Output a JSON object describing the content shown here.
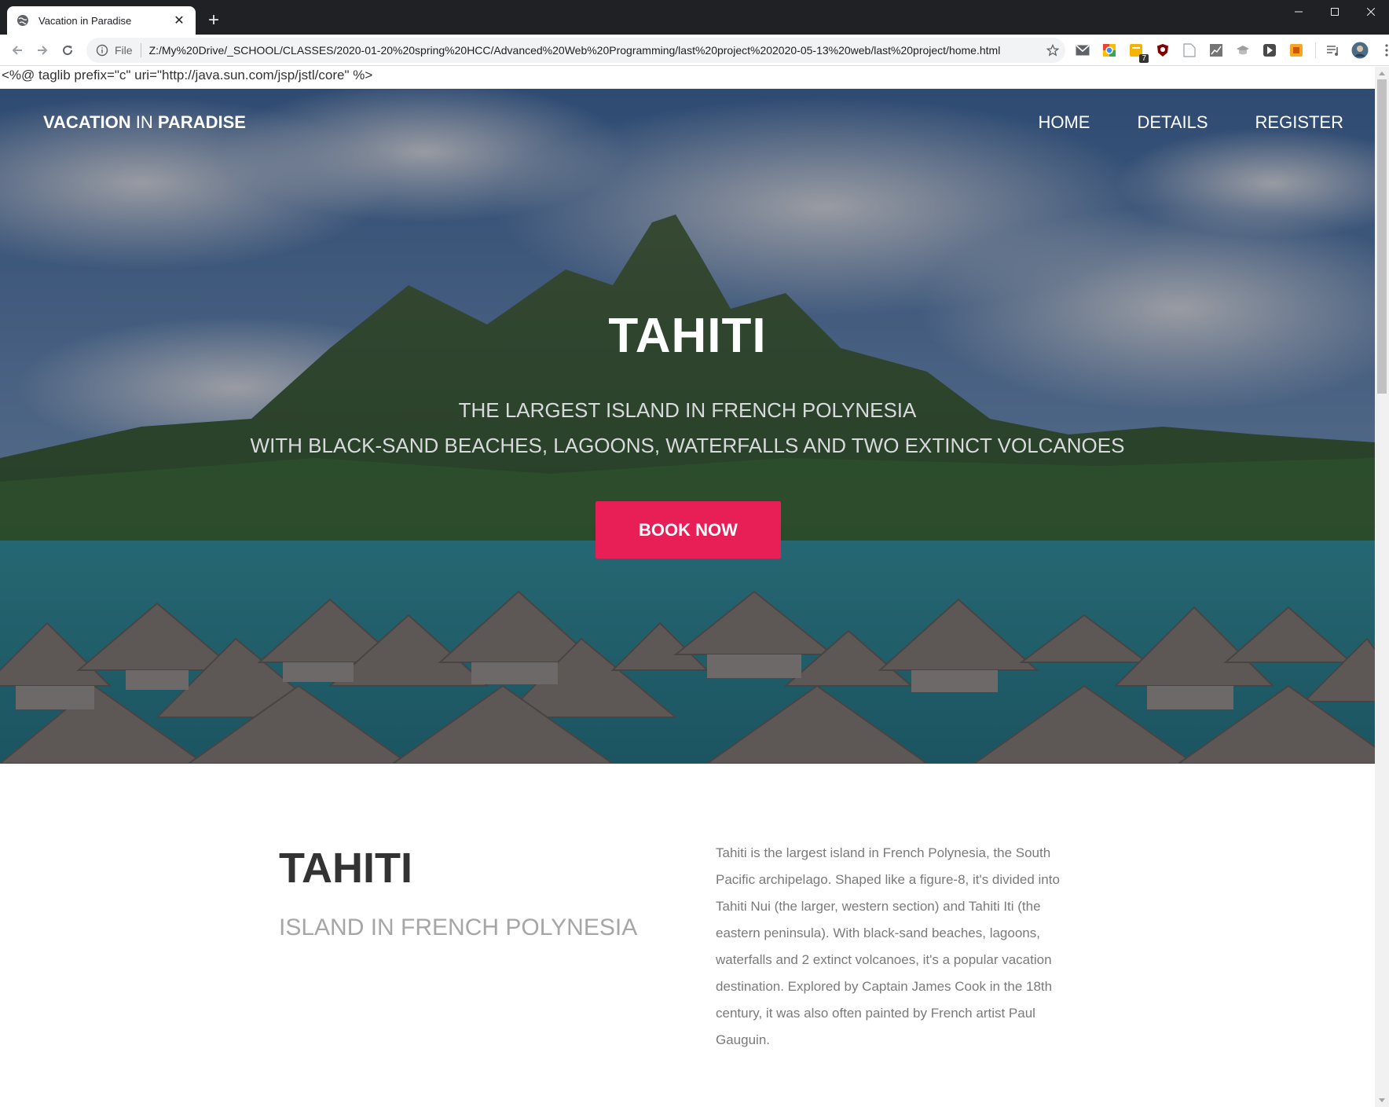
{
  "browser": {
    "tab_title": "Vacation in Paradise",
    "new_tab": "+",
    "address_scheme": "File",
    "url": "Z:/My%20Drive/_SCHOOL/CLASSES/2020-01-20%20spring%20HCC/Advanced%20Web%20Programming/last%20project%202020-05-13%20web/last%20project/home.html",
    "extension_badge": "7"
  },
  "page": {
    "jsp_directive": "<%@ taglib prefix=\"c\" uri=\"http://java.sun.com/jsp/jstl/core\" %>",
    "brand": {
      "part1": "VACATION",
      "part2": "IN",
      "part3": "PARADISE"
    },
    "nav": [
      "HOME",
      "DETAILS",
      "REGISTER"
    ],
    "hero": {
      "title": "TAHITI",
      "subtitle_line1": "THE LARGEST ISLAND IN FRENCH POLYNESIA",
      "subtitle_line2": "WITH BLACK-SAND BEACHES, LAGOONS, WATERFALLS AND TWO EXTINCT VOLCANOES",
      "cta": "BOOK NOW"
    },
    "about": {
      "title": "TAHITI",
      "subtitle": "ISLAND IN FRENCH POLYNESIA",
      "description": "Tahiti is the largest island in French Polynesia, the South Pacific archipelago. Shaped like a figure-8, it's divided into Tahiti Nui (the larger, western section) and Tahiti Iti (the eastern peninsula). With black-sand beaches, lagoons, waterfalls and 2 extinct volcanoes, it's a popular vacation destination. Explored by Captain James Cook in the 18th century, it was also often painted by French artist Paul Gauguin."
    }
  },
  "colors": {
    "cta": "#e81e57",
    "tabstrip": "#202124",
    "heading": "#333333",
    "muted": "#a6a6a6"
  },
  "icons": [
    "globe-icon",
    "close-icon",
    "back-icon",
    "forward-icon",
    "reload-icon",
    "info-icon",
    "star-icon",
    "gmail-icon",
    "menu-icon"
  ]
}
